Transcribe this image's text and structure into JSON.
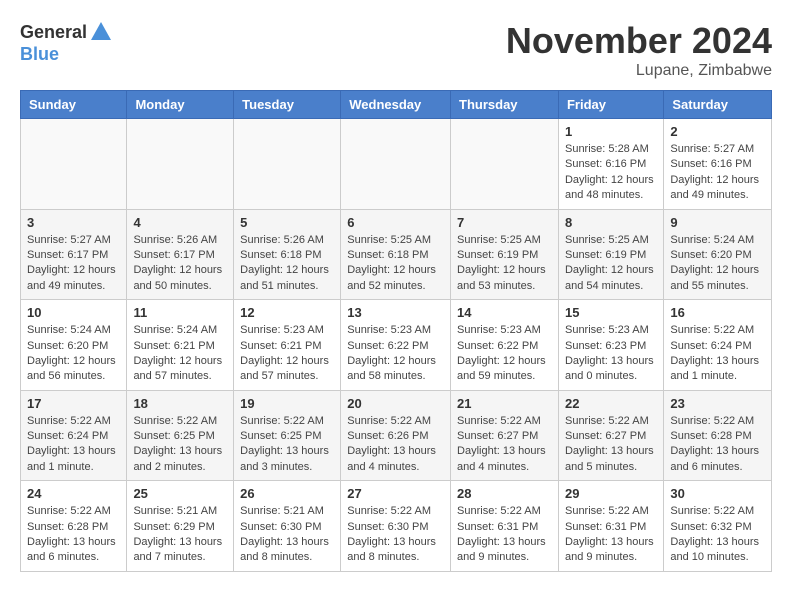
{
  "logo": {
    "general": "General",
    "blue": "Blue"
  },
  "title": "November 2024",
  "location": "Lupane, Zimbabwe",
  "days_of_week": [
    "Sunday",
    "Monday",
    "Tuesday",
    "Wednesday",
    "Thursday",
    "Friday",
    "Saturday"
  ],
  "weeks": [
    [
      {
        "day": "",
        "info": ""
      },
      {
        "day": "",
        "info": ""
      },
      {
        "day": "",
        "info": ""
      },
      {
        "day": "",
        "info": ""
      },
      {
        "day": "",
        "info": ""
      },
      {
        "day": "1",
        "info": "Sunrise: 5:28 AM\nSunset: 6:16 PM\nDaylight: 12 hours and 48 minutes."
      },
      {
        "day": "2",
        "info": "Sunrise: 5:27 AM\nSunset: 6:16 PM\nDaylight: 12 hours and 49 minutes."
      }
    ],
    [
      {
        "day": "3",
        "info": "Sunrise: 5:27 AM\nSunset: 6:17 PM\nDaylight: 12 hours and 49 minutes."
      },
      {
        "day": "4",
        "info": "Sunrise: 5:26 AM\nSunset: 6:17 PM\nDaylight: 12 hours and 50 minutes."
      },
      {
        "day": "5",
        "info": "Sunrise: 5:26 AM\nSunset: 6:18 PM\nDaylight: 12 hours and 51 minutes."
      },
      {
        "day": "6",
        "info": "Sunrise: 5:25 AM\nSunset: 6:18 PM\nDaylight: 12 hours and 52 minutes."
      },
      {
        "day": "7",
        "info": "Sunrise: 5:25 AM\nSunset: 6:19 PM\nDaylight: 12 hours and 53 minutes."
      },
      {
        "day": "8",
        "info": "Sunrise: 5:25 AM\nSunset: 6:19 PM\nDaylight: 12 hours and 54 minutes."
      },
      {
        "day": "9",
        "info": "Sunrise: 5:24 AM\nSunset: 6:20 PM\nDaylight: 12 hours and 55 minutes."
      }
    ],
    [
      {
        "day": "10",
        "info": "Sunrise: 5:24 AM\nSunset: 6:20 PM\nDaylight: 12 hours and 56 minutes."
      },
      {
        "day": "11",
        "info": "Sunrise: 5:24 AM\nSunset: 6:21 PM\nDaylight: 12 hours and 57 minutes."
      },
      {
        "day": "12",
        "info": "Sunrise: 5:23 AM\nSunset: 6:21 PM\nDaylight: 12 hours and 57 minutes."
      },
      {
        "day": "13",
        "info": "Sunrise: 5:23 AM\nSunset: 6:22 PM\nDaylight: 12 hours and 58 minutes."
      },
      {
        "day": "14",
        "info": "Sunrise: 5:23 AM\nSunset: 6:22 PM\nDaylight: 12 hours and 59 minutes."
      },
      {
        "day": "15",
        "info": "Sunrise: 5:23 AM\nSunset: 6:23 PM\nDaylight: 13 hours and 0 minutes."
      },
      {
        "day": "16",
        "info": "Sunrise: 5:22 AM\nSunset: 6:24 PM\nDaylight: 13 hours and 1 minute."
      }
    ],
    [
      {
        "day": "17",
        "info": "Sunrise: 5:22 AM\nSunset: 6:24 PM\nDaylight: 13 hours and 1 minute."
      },
      {
        "day": "18",
        "info": "Sunrise: 5:22 AM\nSunset: 6:25 PM\nDaylight: 13 hours and 2 minutes."
      },
      {
        "day": "19",
        "info": "Sunrise: 5:22 AM\nSunset: 6:25 PM\nDaylight: 13 hours and 3 minutes."
      },
      {
        "day": "20",
        "info": "Sunrise: 5:22 AM\nSunset: 6:26 PM\nDaylight: 13 hours and 4 minutes."
      },
      {
        "day": "21",
        "info": "Sunrise: 5:22 AM\nSunset: 6:27 PM\nDaylight: 13 hours and 4 minutes."
      },
      {
        "day": "22",
        "info": "Sunrise: 5:22 AM\nSunset: 6:27 PM\nDaylight: 13 hours and 5 minutes."
      },
      {
        "day": "23",
        "info": "Sunrise: 5:22 AM\nSunset: 6:28 PM\nDaylight: 13 hours and 6 minutes."
      }
    ],
    [
      {
        "day": "24",
        "info": "Sunrise: 5:22 AM\nSunset: 6:28 PM\nDaylight: 13 hours and 6 minutes."
      },
      {
        "day": "25",
        "info": "Sunrise: 5:21 AM\nSunset: 6:29 PM\nDaylight: 13 hours and 7 minutes."
      },
      {
        "day": "26",
        "info": "Sunrise: 5:21 AM\nSunset: 6:30 PM\nDaylight: 13 hours and 8 minutes."
      },
      {
        "day": "27",
        "info": "Sunrise: 5:22 AM\nSunset: 6:30 PM\nDaylight: 13 hours and 8 minutes."
      },
      {
        "day": "28",
        "info": "Sunrise: 5:22 AM\nSunset: 6:31 PM\nDaylight: 13 hours and 9 minutes."
      },
      {
        "day": "29",
        "info": "Sunrise: 5:22 AM\nSunset: 6:31 PM\nDaylight: 13 hours and 9 minutes."
      },
      {
        "day": "30",
        "info": "Sunrise: 5:22 AM\nSunset: 6:32 PM\nDaylight: 13 hours and 10 minutes."
      }
    ]
  ]
}
